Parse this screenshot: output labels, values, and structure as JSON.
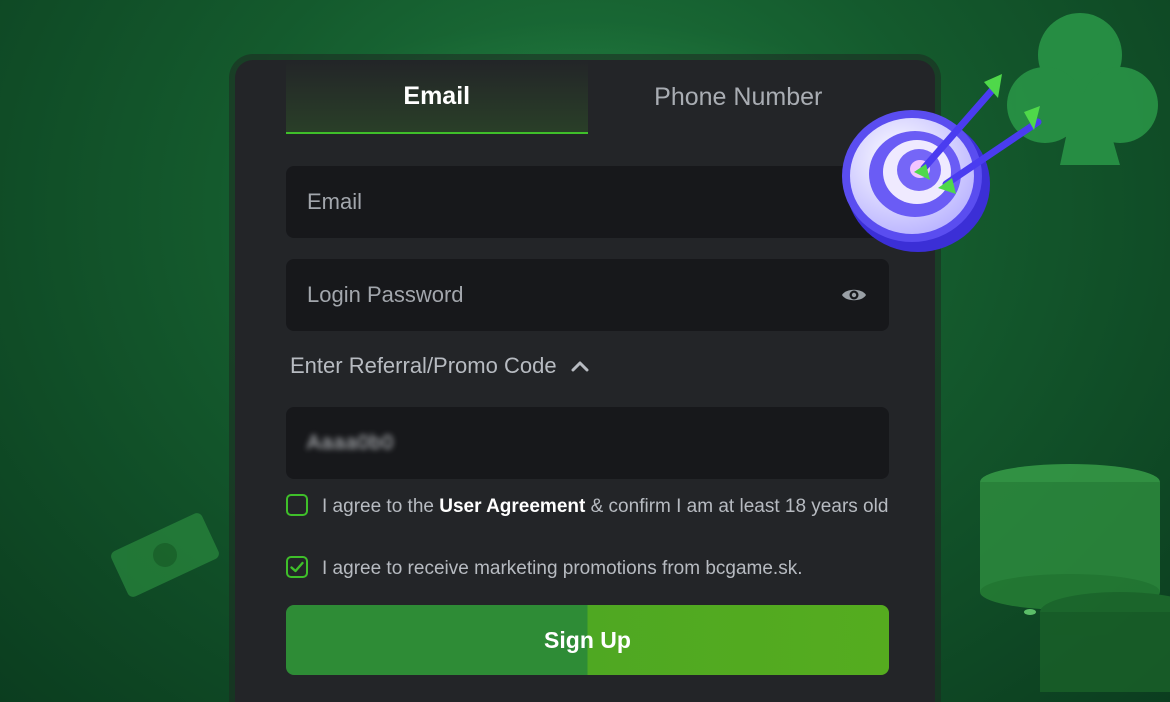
{
  "tabs": [
    {
      "label": "Email",
      "active": true
    },
    {
      "label": "Phone Number",
      "active": false
    }
  ],
  "form": {
    "email_placeholder": "Email",
    "password_placeholder": "Login Password",
    "promo_toggle_label": "Enter Referral/Promo Code",
    "promo_value": "Aaaa0b0"
  },
  "agreements": {
    "terms_prefix": "I agree to the ",
    "terms_link": "User Agreement",
    "terms_suffix": " & confirm I am at least 18 years old",
    "terms_checked": false,
    "marketing": "I agree to receive marketing promotions from bcgame.sk.",
    "marketing_checked": true
  },
  "signup_label": "Sign Up",
  "colors": {
    "accent": "#3fbf2a",
    "card_bg": "#232528",
    "field_bg": "#17181b",
    "page_bg": "#145a2d"
  },
  "icons": [
    "eye-icon",
    "chevron-up-icon",
    "check-icon",
    "target-icon",
    "club-icon"
  ]
}
